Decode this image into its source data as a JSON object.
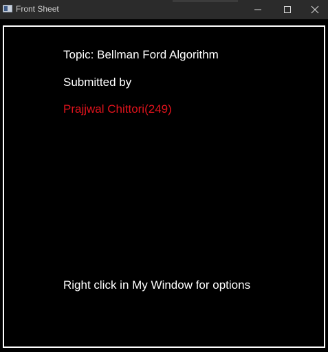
{
  "window": {
    "title": "Front Sheet",
    "icon": "app-window-icon",
    "controls": [
      "minimize",
      "maximize",
      "close"
    ]
  },
  "content": {
    "topic": "Topic: Bellman Ford Algorithm",
    "submitted_by": "Submitted by",
    "author": "Prajjwal Chittori(249)",
    "hint": "Right click in My Window for options"
  },
  "colors": {
    "background": "#000000",
    "text": "#ffffff",
    "author": "#e0131c",
    "titlebar": "#2b2b2b"
  }
}
